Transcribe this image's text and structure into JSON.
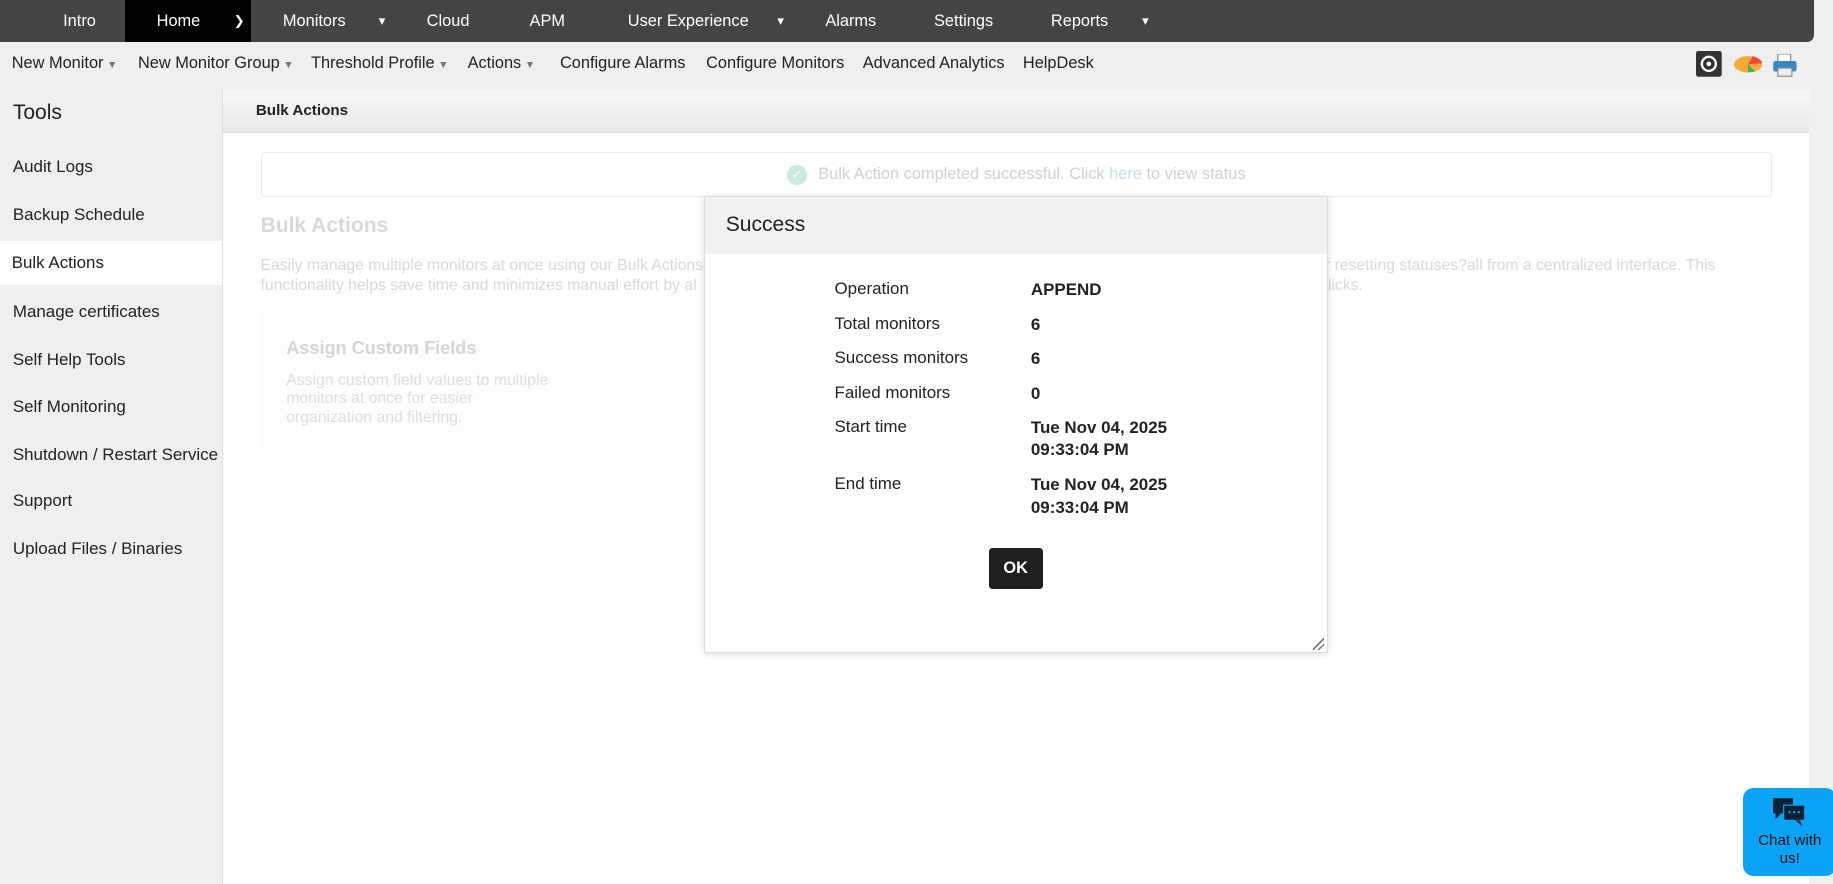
{
  "topnav": {
    "items": [
      {
        "label": "Intro"
      },
      {
        "label": "Home"
      },
      {
        "label": "Monitors"
      },
      {
        "label": "Cloud"
      },
      {
        "label": "APM"
      },
      {
        "label": "User Experience"
      },
      {
        "label": "Alarms"
      },
      {
        "label": "Settings"
      },
      {
        "label": "Reports"
      }
    ]
  },
  "subnav": {
    "items": [
      {
        "label": "New Monitor"
      },
      {
        "label": "New Monitor Group"
      },
      {
        "label": "Threshold Profile"
      },
      {
        "label": "Actions"
      },
      {
        "label": "Configure Alarms"
      },
      {
        "label": "Configure Monitors"
      },
      {
        "label": "Advanced Analytics"
      },
      {
        "label": "HelpDesk"
      }
    ]
  },
  "sidebar": {
    "title": "Tools",
    "items": [
      {
        "label": "Audit Logs"
      },
      {
        "label": "Backup Schedule"
      },
      {
        "label": "Bulk Actions"
      },
      {
        "label": "Manage certificates"
      },
      {
        "label": "Self Help Tools"
      },
      {
        "label": "Self Monitoring"
      },
      {
        "label": "Shutdown / Restart Service"
      },
      {
        "label": "Support"
      },
      {
        "label": "Upload Files / Binaries"
      }
    ]
  },
  "main": {
    "header": "Bulk Actions",
    "alert": {
      "text": "Bulk Action completed successful. Click ",
      "link": "here",
      "suffix": " to view status"
    },
    "title": "Bulk Actions",
    "desc_l1a": "Easily manage multiple monitors at once using our Bulk Actions",
    "desc_l1b": "or resetting statuses?all from a centralized interface. This",
    "desc_l2a": "functionality helps save time and minimizes manual effort by al",
    "desc_l2b": "licks.",
    "card": {
      "title": "Assign Custom Fields",
      "desc": "Assign custom field values to multiple monitors at once for easier organization and filtering."
    }
  },
  "modal": {
    "title": "Success",
    "rows": [
      {
        "label": "Operation",
        "value": "APPEND"
      },
      {
        "label": "Total monitors",
        "value": "6"
      },
      {
        "label": "Success monitors",
        "value": "6"
      },
      {
        "label": "Failed monitors",
        "value": "0"
      },
      {
        "label": "Start time",
        "value": "Tue Nov 04, 2025",
        "value2": "09:33:04 PM"
      },
      {
        "label": "End time",
        "value": "Tue Nov 04, 2025",
        "value2": "09:33:04 PM"
      }
    ],
    "ok": "OK"
  },
  "chat": {
    "label": "Chat with us!"
  }
}
